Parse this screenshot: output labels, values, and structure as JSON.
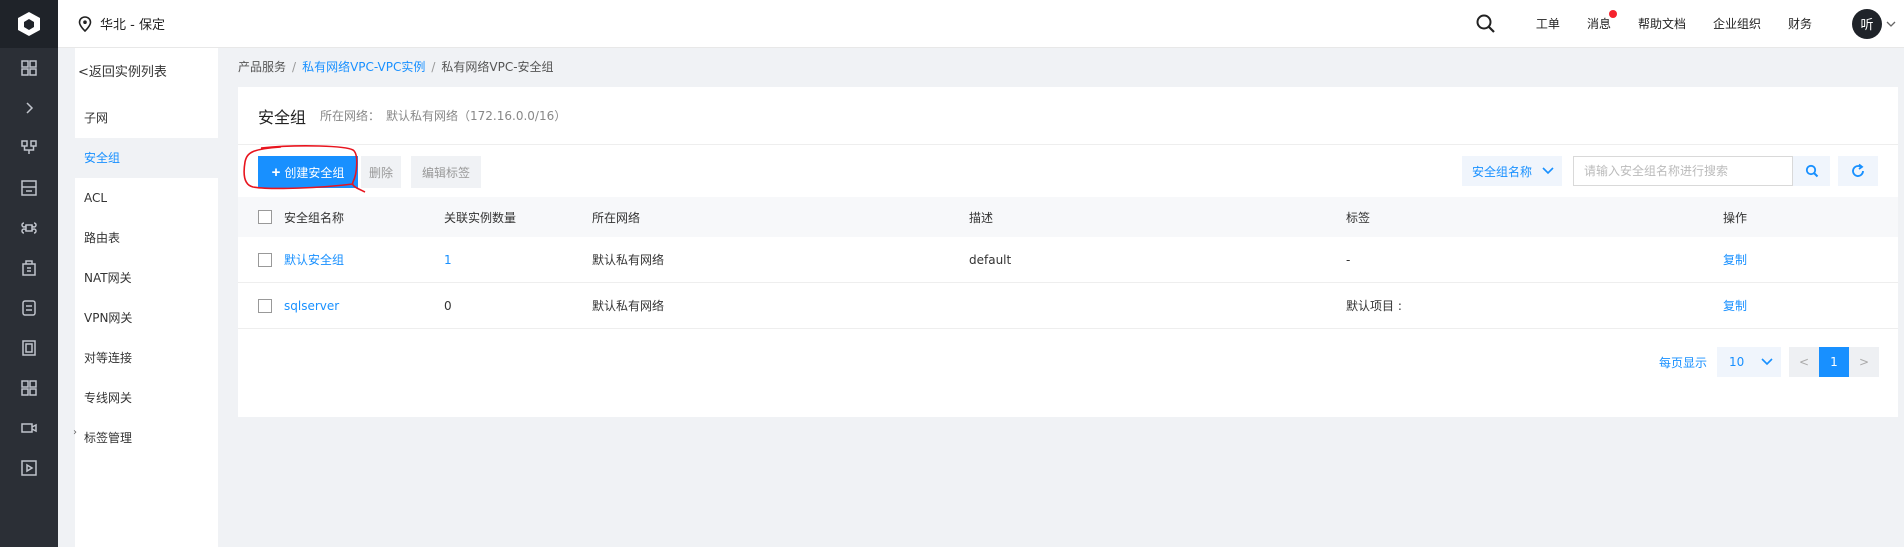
{
  "topbar": {
    "region": "华北 - 保定",
    "links": [
      "工单",
      "消息",
      "帮助文档",
      "企业组织",
      "财务"
    ],
    "avatar": "听"
  },
  "sidenav": {
    "back": "<返回实例列表",
    "items": [
      {
        "label": "子网",
        "active": false
      },
      {
        "label": "安全组",
        "active": true
      },
      {
        "label": "ACL",
        "active": false
      },
      {
        "label": "路由表",
        "active": false
      },
      {
        "label": "NAT网关",
        "active": false
      },
      {
        "label": "VPN网关",
        "active": false
      },
      {
        "label": "对等连接",
        "active": false
      },
      {
        "label": "专线网关",
        "active": false
      },
      {
        "label": "标签管理",
        "active": false
      }
    ]
  },
  "breadcrumb": {
    "items": [
      "产品服务",
      "私有网络VPC-VPC实例",
      "私有网络VPC-安全组"
    ]
  },
  "header": {
    "title": "安全组",
    "network_label": "所在网络：",
    "network_value": "默认私有网络（172.16.0.0/16）"
  },
  "toolbar": {
    "create_label": "创建安全组",
    "delete_label": "删除",
    "edit_tags_label": "编辑标签",
    "filter_field": "安全组名称",
    "search_placeholder": "请输入安全组名称进行搜索"
  },
  "table": {
    "columns": [
      "安全组名称",
      "关联实例数量",
      "所在网络",
      "描述",
      "标签",
      "操作"
    ],
    "rows": [
      {
        "name": "默认安全组",
        "count": "1",
        "network": "默认私有网络",
        "desc": "default",
        "tag": "-",
        "action": "复制"
      },
      {
        "name": "sqlserver",
        "count": "0",
        "network": "默认私有网络",
        "desc": "",
        "tag": "默认项目 :",
        "action": "复制"
      }
    ]
  },
  "pager": {
    "label": "每页显示",
    "page_size": "10",
    "prev": "<",
    "current": "1",
    "next": ">"
  },
  "colors": {
    "primary": "#1890ff",
    "rail": "#2b2f36",
    "annotation": "#e8141e"
  }
}
